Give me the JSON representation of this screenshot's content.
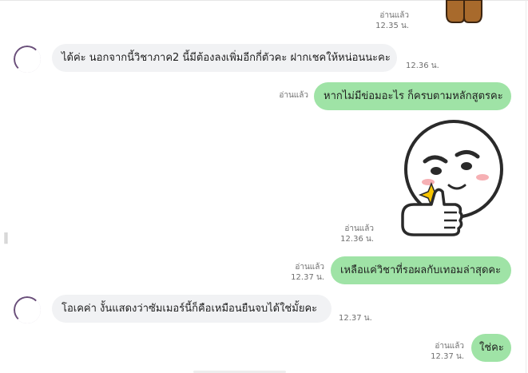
{
  "colors": {
    "incoming_bubble": "#f1f2f4",
    "outgoing_bubble": "#9fe3a6",
    "meta_text": "#6f6f6f"
  },
  "messages": [
    {
      "direction": "outgoing",
      "type": "sticker",
      "sticker": "brown-bear-sticker",
      "read_label": "อ่านแล้ว",
      "time": "12.35 น."
    },
    {
      "direction": "incoming",
      "type": "text",
      "text": "ได้ค่ะ นอกจากนี้วิชาภาค2 นี้มีต้องลงเพิ่มอีกกี่ตัวคะ ฝากเชคให้หน่อนนะคะ",
      "time": "12.36 น."
    },
    {
      "direction": "outgoing",
      "type": "text",
      "text": "หากไม่มีข่อมอะไร ก็ครบตามหลักสูตรคะ",
      "read_label": "อ่านแล้ว"
    },
    {
      "direction": "outgoing",
      "type": "sticker",
      "sticker": "moon-thumbs-up-sticker",
      "read_label": "อ่านแล้ว",
      "time": "12.36 น."
    },
    {
      "direction": "outgoing",
      "type": "text",
      "text": "เหลือแค่วิชาที่รอผลกับเทอมล่าสุดคะ",
      "read_label": "อ่านแล้ว",
      "time": "12.37 น."
    },
    {
      "direction": "incoming",
      "type": "text",
      "text": "โอเคค่า งั้นแสดงว่าซัมเมอร์นี้ก็คือเหมือนยืนจบได้ใช่มั้ยคะ",
      "time": "12.37 น."
    },
    {
      "direction": "outgoing",
      "type": "text",
      "text": "ใช่คะ",
      "read_label": "อ่านแล้ว",
      "time": "12.37 น."
    }
  ]
}
